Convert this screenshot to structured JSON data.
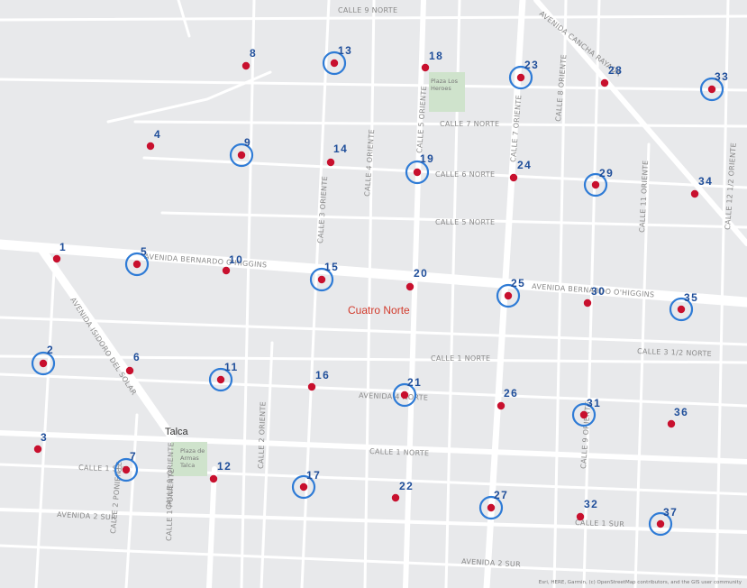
{
  "map": {
    "district_label": "Cuatro Norte",
    "city_label": "Talca",
    "attribution": "Esri, HERE, Garmin, (c) OpenStreetMap contributors, and the GIS user community",
    "colors": {
      "background": "#e8e9eb",
      "street": "#ffffff",
      "park": "#cfe3cc",
      "marker": "#c8102e",
      "ring": "#2e7bd6",
      "number": "#1f4e9a",
      "district_label": "#d23b2c"
    },
    "parks": [
      {
        "name": "Plaza Los Heroes",
        "lines": [
          "Plaza Los",
          "Heroes"
        ]
      },
      {
        "name": "Plaza de Armas Talca",
        "lines": [
          "Plaza de",
          "Armas",
          "Talca"
        ]
      }
    ],
    "streets": [
      {
        "name": "CALLE 9 NORTE"
      },
      {
        "name": "AVENIDA CANCHA RAYADA"
      },
      {
        "name": "CALLE 7 NORTE"
      },
      {
        "name": "CALLE 6 NORTE"
      },
      {
        "name": "CALLE 5 NORTE"
      },
      {
        "name": "AVENIDA BERNARDO O'HIGGINS"
      },
      {
        "name": "AVENIDA BERNARDO O'HIGGINS"
      },
      {
        "name": "CALLE 1 NORTE"
      },
      {
        "name": "CALLE 3 1/2 NORTE"
      },
      {
        "name": "AVENIDA 4 NORTE"
      },
      {
        "name": "CALLE 1 NORTE"
      },
      {
        "name": "AVENIDA 2 SUR"
      },
      {
        "name": "AVENIDA 2 SUR"
      },
      {
        "name": "CALLE 1 SUR"
      },
      {
        "name": "CALLE 1 SUR"
      },
      {
        "name": "CALLE 1 ORIENTE"
      },
      {
        "name": "CALLE 2 ORIENTE"
      },
      {
        "name": "CALLE 3 ORIENTE"
      },
      {
        "name": "CALLE 4 ORIENTE"
      },
      {
        "name": "CALLE 5 ORIENTE"
      },
      {
        "name": "CALLE 7 ORIENTE"
      },
      {
        "name": "CALLE 8 ORIENTE"
      },
      {
        "name": "CALLE 9 ORIENTE"
      },
      {
        "name": "CALLE 11 ORIENTE"
      },
      {
        "name": "CALLE 12 1/2 ORIENTE"
      },
      {
        "name": "AVENIDA ISIDORO DEL SOLAR"
      },
      {
        "name": "CALLE 1 PONIENTE"
      },
      {
        "name": "CALLE 2 PONIENTE"
      }
    ],
    "points": [
      {
        "id": "1",
        "ringed": false
      },
      {
        "id": "2",
        "ringed": true
      },
      {
        "id": "3",
        "ringed": false
      },
      {
        "id": "4",
        "ringed": false
      },
      {
        "id": "5",
        "ringed": true
      },
      {
        "id": "6",
        "ringed": false
      },
      {
        "id": "7",
        "ringed": true
      },
      {
        "id": "8",
        "ringed": false
      },
      {
        "id": "9",
        "ringed": true
      },
      {
        "id": "10",
        "ringed": false
      },
      {
        "id": "11",
        "ringed": true
      },
      {
        "id": "12",
        "ringed": false
      },
      {
        "id": "13",
        "ringed": true
      },
      {
        "id": "14",
        "ringed": false
      },
      {
        "id": "15",
        "ringed": true
      },
      {
        "id": "16",
        "ringed": false
      },
      {
        "id": "17",
        "ringed": true
      },
      {
        "id": "18",
        "ringed": false
      },
      {
        "id": "19",
        "ringed": true
      },
      {
        "id": "20",
        "ringed": false
      },
      {
        "id": "21",
        "ringed": true
      },
      {
        "id": "22",
        "ringed": false
      },
      {
        "id": "23",
        "ringed": true
      },
      {
        "id": "24",
        "ringed": false
      },
      {
        "id": "25",
        "ringed": true
      },
      {
        "id": "26",
        "ringed": false
      },
      {
        "id": "27",
        "ringed": true
      },
      {
        "id": "28",
        "ringed": false
      },
      {
        "id": "29",
        "ringed": true
      },
      {
        "id": "30",
        "ringed": false
      },
      {
        "id": "31",
        "ringed": true
      },
      {
        "id": "32",
        "ringed": false
      },
      {
        "id": "33",
        "ringed": true
      },
      {
        "id": "34",
        "ringed": false
      },
      {
        "id": "35",
        "ringed": true
      },
      {
        "id": "36",
        "ringed": false
      },
      {
        "id": "37",
        "ringed": true
      }
    ]
  }
}
